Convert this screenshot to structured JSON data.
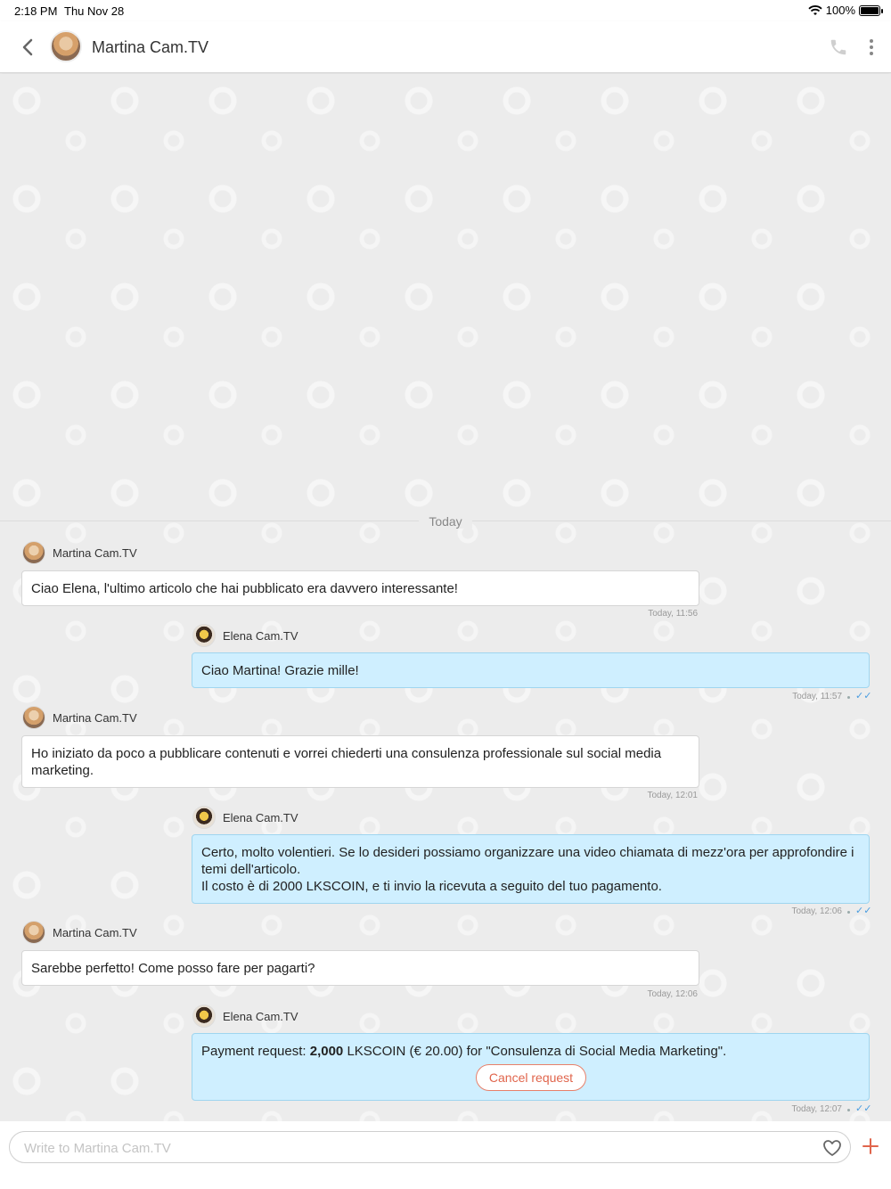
{
  "statusbar": {
    "time": "2:18 PM",
    "date": "Thu Nov 28",
    "battery": "100%"
  },
  "header": {
    "title": "Martina Cam.TV"
  },
  "chat": {
    "day_label": "Today"
  },
  "messages": [
    {
      "sender": "Martina Cam.TV",
      "text": "Ciao Elena, l'ultimo articolo che hai pubblicato era davvero interessante!",
      "time": "Today, 11:56"
    },
    {
      "sender": "Elena Cam.TV",
      "text": "Ciao Martina! Grazie mille!",
      "time": "Today, 11:57",
      "status": "✓✓"
    },
    {
      "sender": "Martina Cam.TV",
      "text": "Ho iniziato da poco a pubblicare contenuti e vorrei chiederti una consulenza professionale sul social media marketing.",
      "time": "Today, 12:01"
    },
    {
      "sender": "Elena Cam.TV",
      "line1": "Certo, molto volentieri. Se lo desideri possiamo organizzare una video chiamata di mezz'ora per approfondire i temi dell'articolo.",
      "line2": "Il costo è di 2000 LKSCOIN, e ti invio la ricevuta a seguito del tuo pagamento.",
      "time": "Today, 12:06",
      "status": "✓✓"
    },
    {
      "sender": "Martina Cam.TV",
      "text": "Sarebbe perfetto! Come posso fare per pagarti?",
      "time": "Today, 12:06"
    },
    {
      "sender": "Elena Cam.TV",
      "prefix": "Payment request: ",
      "amount": "2,000",
      "suffix": " LKSCOIN (€ 20.00) for \"Consulenza di Social Media Marketing\".",
      "button": "Cancel request",
      "time": "Today, 12:07",
      "status": "✓✓"
    }
  ],
  "composer": {
    "placeholder": "Write to Martina Cam.TV"
  },
  "colors": {
    "outgoing_bubble": "#cfefff",
    "accent": "#e0654c",
    "read_check": "#4a9de0"
  }
}
